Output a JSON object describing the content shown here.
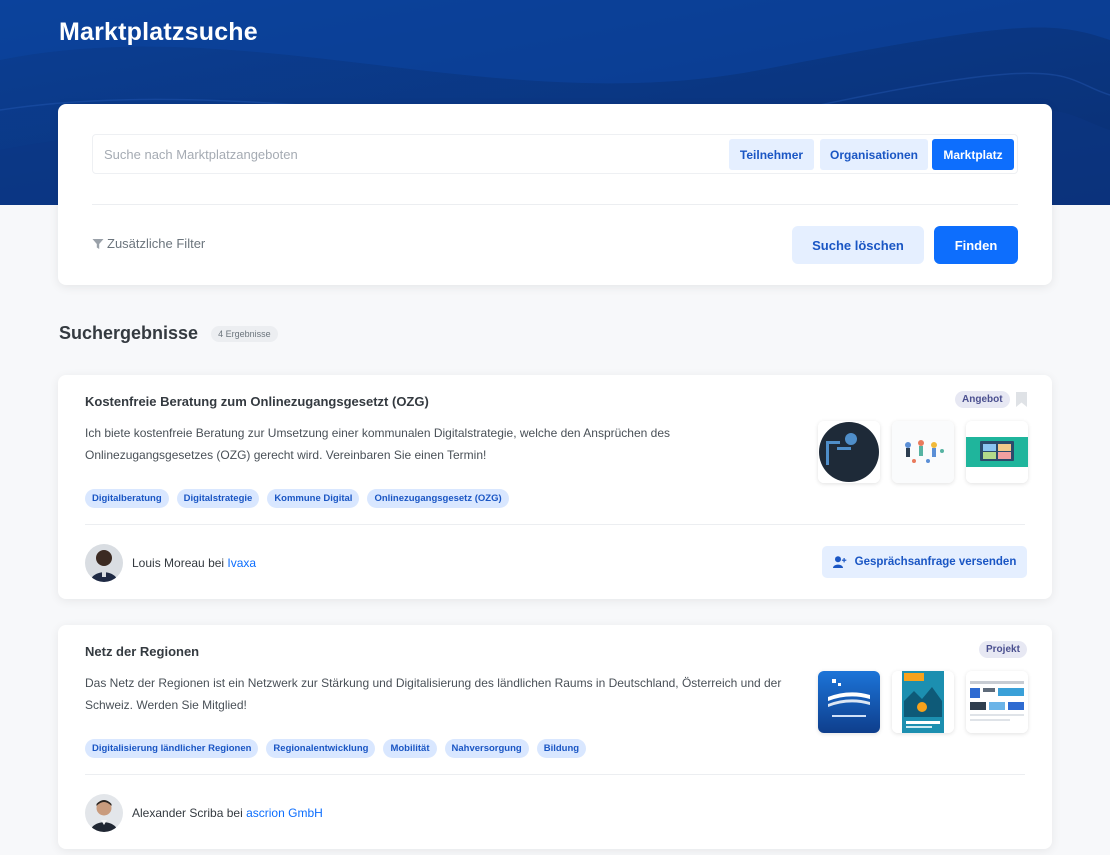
{
  "header": {
    "title": "Marktplatzsuche"
  },
  "search": {
    "placeholder": "Suche nach Marktplatzangeboten",
    "value": "",
    "scopes": [
      "Teilnehmer",
      "Organisationen",
      "Marktplatz"
    ],
    "active_scope": "Marktplatz",
    "filter_label": "Zusätzliche Filter",
    "clear_label": "Suche löschen",
    "find_label": "Finden"
  },
  "results": {
    "title": "Suchergebnisse",
    "count": "4 Ergebnisse",
    "items": [
      {
        "title": "Kostenfreie Beratung zum Onlinezugangsgesetzt (OZG)",
        "type": "Angebot",
        "text": "Ich biete kostenfreie Beratung zur Umsetzung einer kommunalen Digitalstrategie, welche den Ansprüchen des Onlinezugangsgesetzes (OZG) gerecht wird. Vereinbaren Sie einen Termin!",
        "tags": [
          "Digitalberatung",
          "Digitalstrategie",
          "Kommune Digital",
          "Onlinezugangsgesetz (OZG)"
        ],
        "person": "Louis Moreau",
        "connector": "bei",
        "org": "Ivaxa",
        "action": "Gesprächsanfrage versenden",
        "thumbs": [
          "silhouette-image",
          "illustration-image",
          "video-call-image"
        ]
      },
      {
        "title": "Netz der Regionen",
        "type": "Projekt",
        "text": "Das Netz der Regionen ist ein Netzwerk zur Stärkung und Digitalisierung des ländlichen Raums in Deutschland, Österreich und der Schweiz. Werden Sie Mitglied!",
        "tags": [
          "Digitalisierung ländlicher Regionen",
          "Regionalentwicklung",
          "Mobilität",
          "Nahversorgung",
          "Bildung"
        ],
        "person": "Alexander Scriba",
        "connector": "bei",
        "org": "ascrion GmbH",
        "thumbs": [
          "logo-image",
          "poster-image",
          "website-screenshot-image"
        ]
      }
    ]
  },
  "colors": {
    "primary": "#0d6efd",
    "hero": "#0a3d91",
    "light_button": "#e5efff",
    "tag_bg": "#d9e7ff"
  },
  "icons": {
    "filter": "filter-icon",
    "bookmark": "bookmark-icon",
    "add_user": "add-user-icon"
  }
}
